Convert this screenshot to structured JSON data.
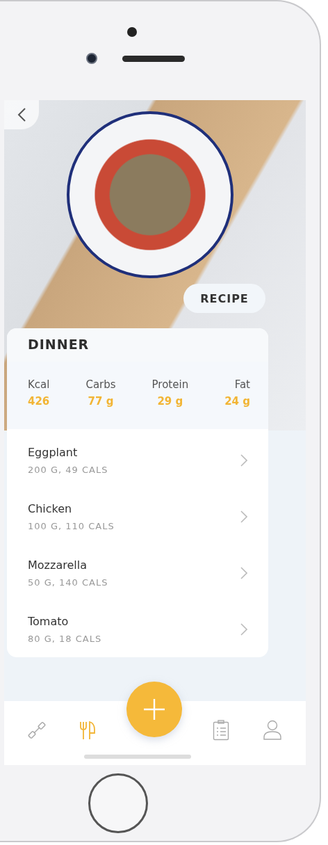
{
  "photo": {
    "recipe_button": "RECIPE"
  },
  "meal": {
    "title": "DINNER",
    "nutrients": [
      {
        "label": "Kcal",
        "value": "426"
      },
      {
        "label": "Carbs",
        "value": "77 g"
      },
      {
        "label": "Protein",
        "value": "29 g"
      },
      {
        "label": "Fat",
        "value": "24 g"
      }
    ],
    "ingredients": [
      {
        "name": "Eggplant",
        "detail": "200 G, 49 CALS"
      },
      {
        "name": "Chicken",
        "detail": "100 G, 110 CALS"
      },
      {
        "name": "Mozzarella",
        "detail": "50 G, 140 CALS"
      },
      {
        "name": "Tomato",
        "detail": "80 G, 18 CALS"
      }
    ]
  },
  "nav": {
    "items": [
      {
        "kind": "workout",
        "selected": false
      },
      {
        "kind": "meals",
        "selected": true
      },
      {
        "kind": "add",
        "selected": false
      },
      {
        "kind": "plan",
        "selected": false
      },
      {
        "kind": "profile",
        "selected": false
      }
    ]
  }
}
